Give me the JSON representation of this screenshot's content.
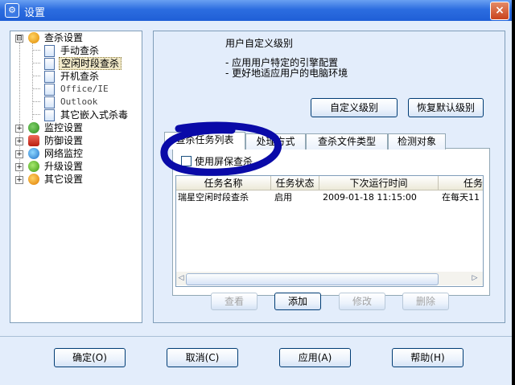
{
  "window": {
    "title": "设置",
    "close": "×"
  },
  "tree": {
    "items": [
      {
        "label": "查杀设置",
        "expander": "⊟"
      },
      {
        "label": "手动查杀"
      },
      {
        "label": "空闲时段查杀"
      },
      {
        "label": "开机查杀"
      },
      {
        "label": "Office/IE"
      },
      {
        "label": "Outlook"
      },
      {
        "label": "其它嵌入式杀毒"
      },
      {
        "label": "监控设置",
        "expander": "+"
      },
      {
        "label": "防御设置",
        "expander": "+"
      },
      {
        "label": "网络监控",
        "expander": "+"
      },
      {
        "label": "升级设置",
        "expander": "+"
      },
      {
        "label": "其它设置",
        "expander": "+"
      }
    ]
  },
  "level": {
    "heading": "用户自定义级别",
    "bullets": [
      "- 应用用户特定的引擎配置",
      "- 更好地适应用户的电脑环境"
    ],
    "custom_button": "自定义级别",
    "restore_button": "恢复默认级别"
  },
  "tabs": [
    "查杀任务列表",
    "处理方式",
    "查杀文件类型",
    "检测对象"
  ],
  "screensaver_label": "使用屏保查杀",
  "list": {
    "columns": [
      "任务名称",
      "任务状态",
      "下次运行时间",
      "任务"
    ],
    "rows": [
      {
        "name": "瑞星空闲时段查杀",
        "status": "启用",
        "next_run": "2009-01-18 11:15:00",
        "task": "在每天11"
      }
    ]
  },
  "list_buttons": {
    "view": "查看",
    "add": "添加",
    "modify": "修改",
    "delete": "删除"
  },
  "footer": {
    "ok": "确定(O)",
    "cancel": "取消(C)",
    "apply": "应用(A)",
    "help": "帮助(H)"
  },
  "annotation_color": "#0a0aa8"
}
